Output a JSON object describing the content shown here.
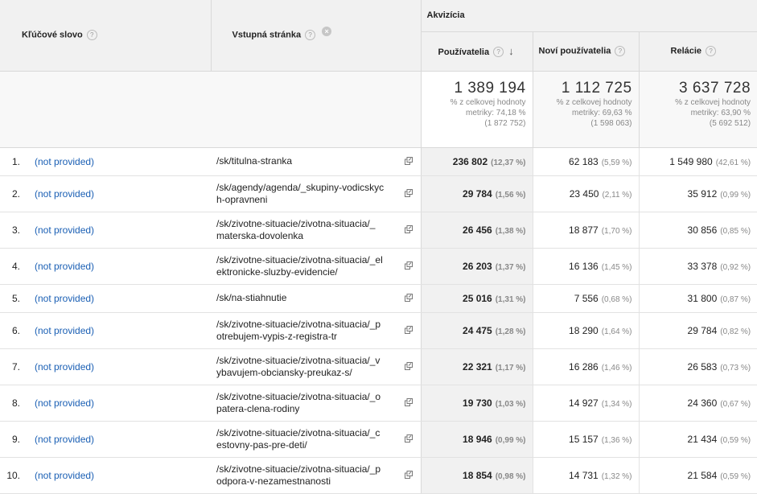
{
  "header": {
    "keyword_label": "Kľúčové slovo",
    "landing_label": "Vstupná stránka",
    "group_label": "Akvizícia",
    "users_label": "Používatelia",
    "new_users_label": "Noví používatelia",
    "sessions_label": "Relácie",
    "help_glyph": "?",
    "remove_glyph": "×",
    "sort_glyph": "↓"
  },
  "totals": {
    "users": {
      "value": "1 389 194",
      "l1": "% z celkovej hodnoty",
      "l2": "metriky: 74,18 %",
      "l3": "(1 872 752)"
    },
    "new_users": {
      "value": "1 112 725",
      "l1": "% z celkovej hodnoty",
      "l2": "metriky: 69,63 %",
      "l3": "(1 598 063)"
    },
    "sessions": {
      "value": "3 637 728",
      "l1": "% z celkovej hodnoty",
      "l2": "metriky: 63,90 %",
      "l3": "(5 692 512)"
    }
  },
  "rows": [
    {
      "idx": "1.",
      "kw": "(not provided)",
      "page": "/sk/titulna-stranka",
      "users": "236 802",
      "users_pct": "(12,37 %)",
      "new": "62 183",
      "new_pct": "(5,59 %)",
      "sess": "1 549 980",
      "sess_pct": "(42,61 %)"
    },
    {
      "idx": "2.",
      "kw": "(not provided)",
      "page": "/sk/agendy/agenda/_skupiny-vodicskyc\nh-opravneni",
      "users": "29 784",
      "users_pct": "(1,56 %)",
      "new": "23 450",
      "new_pct": "(2,11 %)",
      "sess": "35 912",
      "sess_pct": "(0,99 %)"
    },
    {
      "idx": "3.",
      "kw": "(not provided)",
      "page": "/sk/zivotne-situacie/zivotna-situacia/_\nmaterska-dovolenka",
      "users": "26 456",
      "users_pct": "(1,38 %)",
      "new": "18 877",
      "new_pct": "(1,70 %)",
      "sess": "30 856",
      "sess_pct": "(0,85 %)"
    },
    {
      "idx": "4.",
      "kw": "(not provided)",
      "page": "/sk/zivotne-situacie/zivotna-situacia/_el\nektronicke-sluzby-evidencie/",
      "users": "26 203",
      "users_pct": "(1,37 %)",
      "new": "16 136",
      "new_pct": "(1,45 %)",
      "sess": "33 378",
      "sess_pct": "(0,92 %)"
    },
    {
      "idx": "5.",
      "kw": "(not provided)",
      "page": "/sk/na-stiahnutie",
      "users": "25 016",
      "users_pct": "(1,31 %)",
      "new": "7 556",
      "new_pct": "(0,68 %)",
      "sess": "31 800",
      "sess_pct": "(0,87 %)"
    },
    {
      "idx": "6.",
      "kw": "(not provided)",
      "page": "/sk/zivotne-situacie/zivotna-situacia/_p\notrebujem-vypis-z-registra-tr",
      "users": "24 475",
      "users_pct": "(1,28 %)",
      "new": "18 290",
      "new_pct": "(1,64 %)",
      "sess": "29 784",
      "sess_pct": "(0,82 %)"
    },
    {
      "idx": "7.",
      "kw": "(not provided)",
      "page": "/sk/zivotne-situacie/zivotna-situacia/_v\nybavujem-obciansky-preukaz-s/",
      "users": "22 321",
      "users_pct": "(1,17 %)",
      "new": "16 286",
      "new_pct": "(1,46 %)",
      "sess": "26 583",
      "sess_pct": "(0,73 %)"
    },
    {
      "idx": "8.",
      "kw": "(not provided)",
      "page": "/sk/zivotne-situacie/zivotna-situacia/_o\npatera-clena-rodiny",
      "users": "19 730",
      "users_pct": "(1,03 %)",
      "new": "14 927",
      "new_pct": "(1,34 %)",
      "sess": "24 360",
      "sess_pct": "(0,67 %)"
    },
    {
      "idx": "9.",
      "kw": "(not provided)",
      "page": "/sk/zivotne-situacie/zivotna-situacia/_c\nestovny-pas-pre-deti/",
      "users": "18 946",
      "users_pct": "(0,99 %)",
      "new": "15 157",
      "new_pct": "(1,36 %)",
      "sess": "21 434",
      "sess_pct": "(0,59 %)"
    },
    {
      "idx": "10.",
      "kw": "(not provided)",
      "page": "/sk/zivotne-situacie/zivotna-situacia/_p\nodpora-v-nezamestnanosti",
      "users": "18 854",
      "users_pct": "(0,98 %)",
      "new": "14 731",
      "new_pct": "(1,32 %)",
      "sess": "21 584",
      "sess_pct": "(0,59 %)"
    }
  ]
}
